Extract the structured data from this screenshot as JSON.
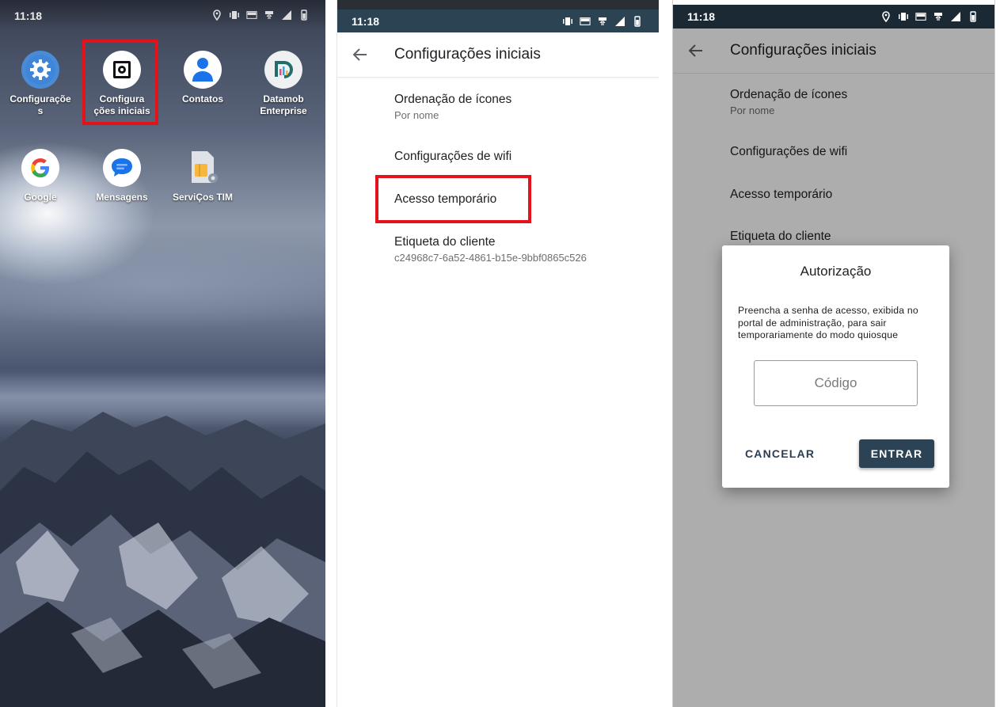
{
  "colors": {
    "highlight_red": "#e3121b",
    "status_bar_teal": "#2c4354",
    "status_bar_dark": "#1b2935",
    "primary_button": "#2b4354"
  },
  "home_screen": {
    "time": "11:18",
    "apps": [
      {
        "icon": "gear-icon",
        "label": "Configuraçõe\ns"
      },
      {
        "icon": "settings-box-icon",
        "label": "Configura\nções iniciais"
      },
      {
        "icon": "person-icon",
        "label": "Contatos"
      },
      {
        "icon": "datamob-icon",
        "label": "Datamob\nEnterprise"
      },
      {
        "icon": "google-icon",
        "label": "Google"
      },
      {
        "icon": "chat-bubble-icon",
        "label": "Mensagens"
      },
      {
        "icon": "sim-card-icon",
        "label": "ServiÇos TIM"
      }
    ]
  },
  "settings_screen": {
    "time": "11:18",
    "title": "Configurações iniciais",
    "items": [
      {
        "label": "Ordenação de ícones",
        "sublabel": "Por nome"
      },
      {
        "label": "Configurações de wifi"
      },
      {
        "label": "Acesso temporário"
      },
      {
        "label": "Etiqueta do cliente",
        "sublabel": "c24968c7-6a52-4861-b15e-9bbf0865c526"
      }
    ]
  },
  "auth_screen": {
    "time": "11:18",
    "title": "Configurações iniciais",
    "items": [
      {
        "label": "Ordenação de ícones",
        "sublabel": "Por nome"
      },
      {
        "label": "Configurações de wifi"
      },
      {
        "label": "Acesso temporário"
      },
      {
        "label": "Etiqueta do cliente"
      }
    ],
    "dialog": {
      "title": "Autorização",
      "message": "Preencha a senha de acesso, exibida no portal de administração, para sair temporariamente do modo quiosque",
      "input_placeholder": "Código",
      "cancel_label": "CANCELAR",
      "enter_label": "ENTRAR"
    }
  }
}
